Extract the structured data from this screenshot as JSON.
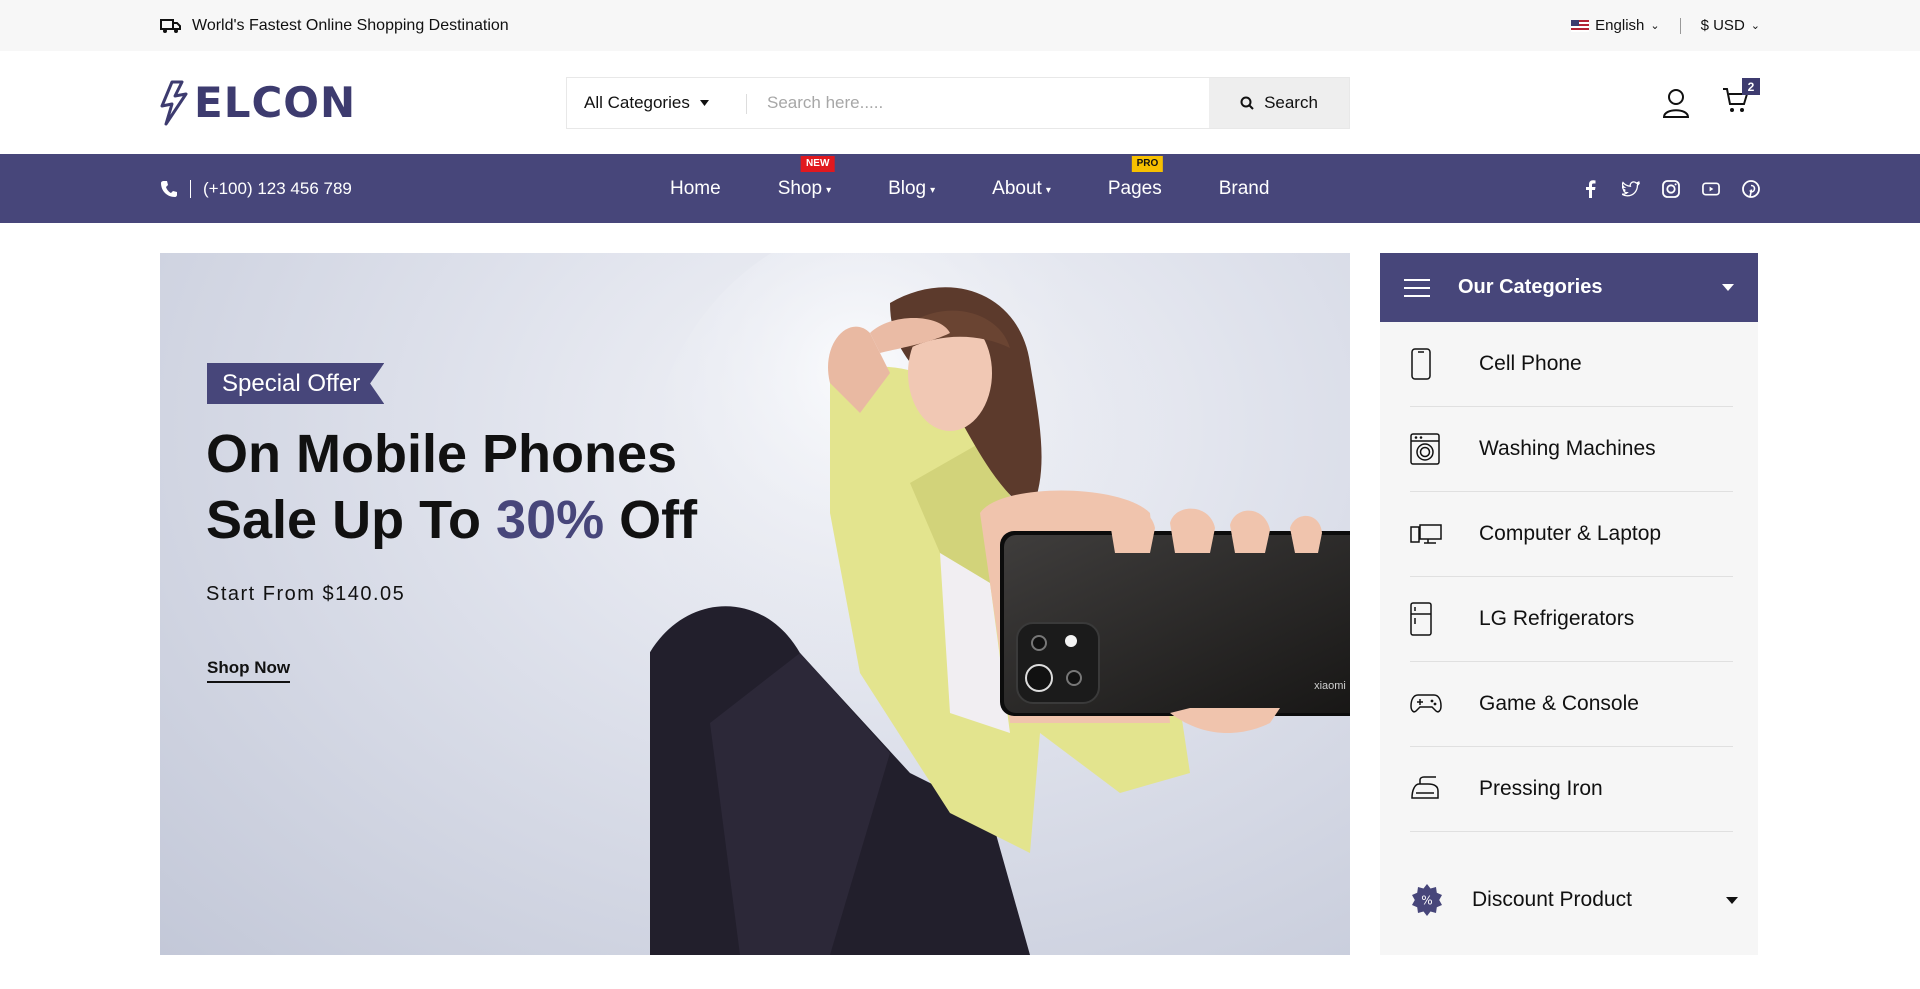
{
  "topbar": {
    "promo": "World's Fastest Online Shopping Destination",
    "language": "English",
    "currency": "$ USD"
  },
  "header": {
    "logo": "ELCON",
    "category_select": "All Categories",
    "search_placeholder": "Search here.....",
    "search_button": "Search",
    "cart_count": "2"
  },
  "nav": {
    "phone": "(+100) 123 456 789",
    "items": [
      {
        "label": "Home"
      },
      {
        "label": "Shop",
        "tag": "NEW"
      },
      {
        "label": "Blog"
      },
      {
        "label": "About"
      },
      {
        "label": "Pages",
        "tag": "PRO"
      },
      {
        "label": "Brand"
      }
    ],
    "social": [
      "facebook-icon",
      "twitter-icon",
      "instagram-icon",
      "youtube-icon",
      "pinterest-icon"
    ]
  },
  "banner": {
    "tag": "Special Offer",
    "line1": "On Mobile Phones",
    "line2_pre": "Sale Up To ",
    "line2_accent": "30%",
    "line2_post": " Off",
    "price": "Start From $140.05",
    "cta": "Shop Now",
    "phone_brand": "xiaomi"
  },
  "categories": {
    "title": "Our Categories",
    "items": [
      {
        "label": "Cell Phone",
        "icon": "cell-phone-icon"
      },
      {
        "label": "Washing Machines",
        "icon": "washing-machine-icon"
      },
      {
        "label": "Computer & Laptop",
        "icon": "computer-icon"
      },
      {
        "label": "LG Refrigerators",
        "icon": "refrigerator-icon"
      },
      {
        "label": "Game & Console",
        "icon": "gamepad-icon"
      },
      {
        "label": "Pressing Iron",
        "icon": "iron-icon"
      }
    ],
    "discount": "Discount Product"
  },
  "colors": {
    "brand": "#47467a",
    "new_tag": "#e1181e",
    "pro_tag": "#f7c000"
  }
}
